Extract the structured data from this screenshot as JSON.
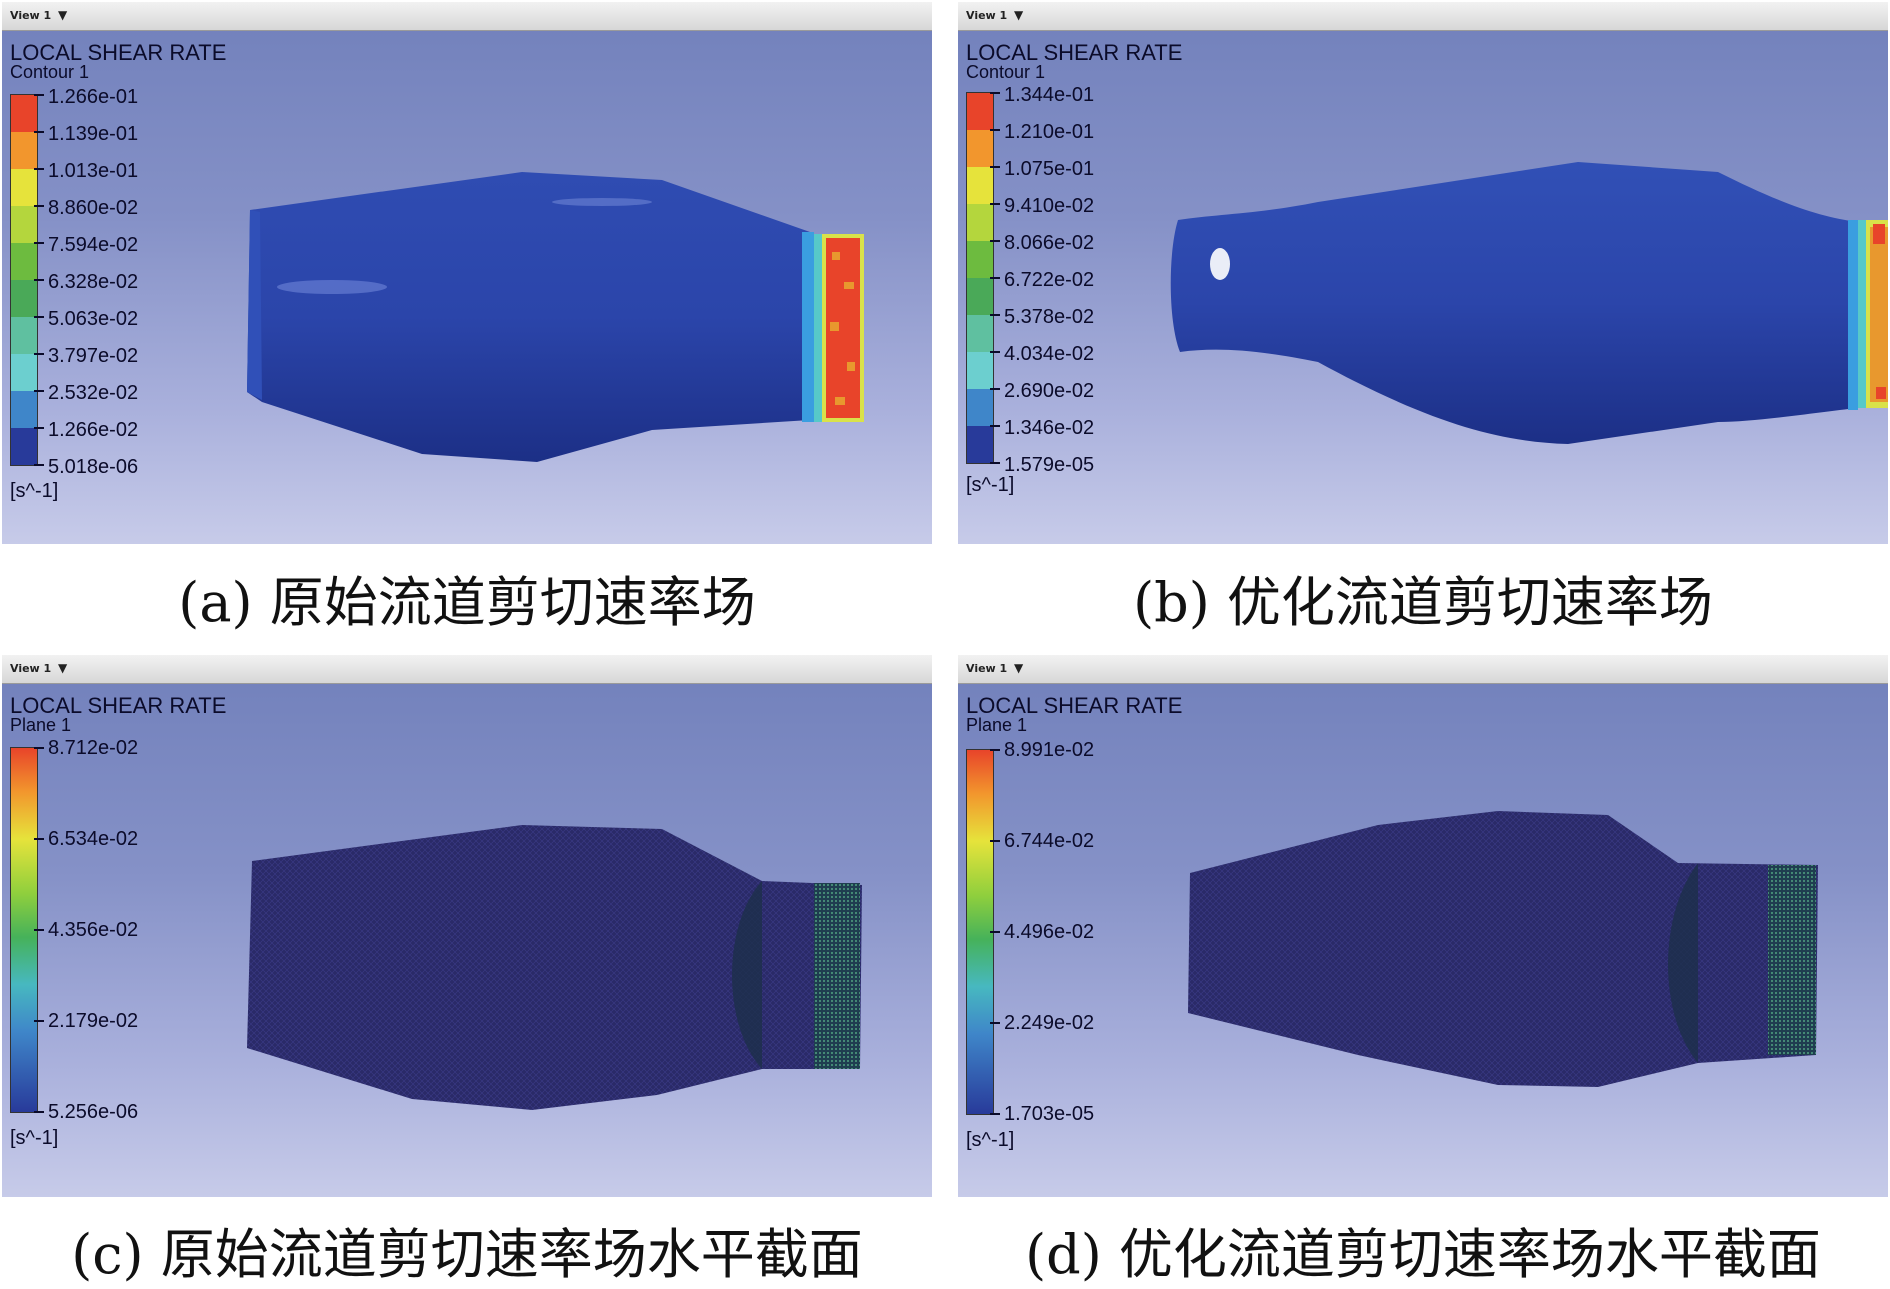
{
  "panels": [
    {
      "view_label": "View 1",
      "title": "LOCAL SHEAR RATE",
      "subtitle": "Contour 1",
      "unit": "[s^-1]",
      "levels": [
        "1.266e-01",
        "1.139e-01",
        "1.013e-01",
        "8.860e-02",
        "7.594e-02",
        "6.328e-02",
        "5.063e-02",
        "3.797e-02",
        "2.532e-02",
        "1.266e-02",
        "5.018e-06"
      ],
      "caption": "(a) 原始流道剪切速率场"
    },
    {
      "view_label": "View 1",
      "title": "LOCAL SHEAR RATE",
      "subtitle": "Contour 1",
      "unit": "[s^-1]",
      "levels": [
        "1.344e-01",
        "1.210e-01",
        "1.075e-01",
        "9.410e-02",
        "8.066e-02",
        "6.722e-02",
        "5.378e-02",
        "4.034e-02",
        "2.690e-02",
        "1.346e-02",
        "1.579e-05"
      ],
      "caption": "(b) 优化流道剪切速率场"
    },
    {
      "view_label": "View 1",
      "title": "LOCAL SHEAR RATE",
      "subtitle": "Plane 1",
      "unit": "[s^-1]",
      "levels": [
        "8.712e-02",
        "6.534e-02",
        "4.356e-02",
        "2.179e-02",
        "5.256e-06"
      ],
      "caption": "(c) 原始流道剪切速率场水平截面"
    },
    {
      "view_label": "View 1",
      "title": "LOCAL SHEAR RATE",
      "subtitle": "Plane 1",
      "unit": "[s^-1]",
      "levels": [
        "8.991e-02",
        "6.744e-02",
        "4.496e-02",
        "2.249e-02",
        "1.703e-05"
      ],
      "caption": "(d) 优化流道剪切速率场水平截面"
    }
  ],
  "colors": {
    "body_blue": "#2d46a8",
    "mesh_dark": "#2a2a68",
    "outlet_red": "#e8442a",
    "outlet_orange": "#e8982e",
    "outlet_yellow": "#d9e24a",
    "outlet_cyan": "#38b6d8"
  }
}
